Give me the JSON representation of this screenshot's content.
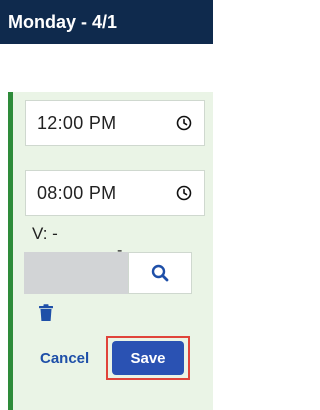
{
  "header": {
    "title": "Monday - 4/1"
  },
  "schedule": {
    "start_time": "12:00 PM",
    "separator": "-",
    "end_time": "08:00 PM",
    "v_label": "V: -"
  },
  "actions": {
    "cancel_label": "Cancel",
    "save_label": "Save"
  },
  "icons": {
    "clock": "clock-icon",
    "search": "search-icon",
    "trash": "trash-icon"
  },
  "colors": {
    "header_bg": "#0f2a4d",
    "accent_green": "#2e8b3a",
    "panel_bg": "#eaf4e6",
    "primary_blue": "#2a52b3",
    "highlight_red": "#e0443a"
  }
}
